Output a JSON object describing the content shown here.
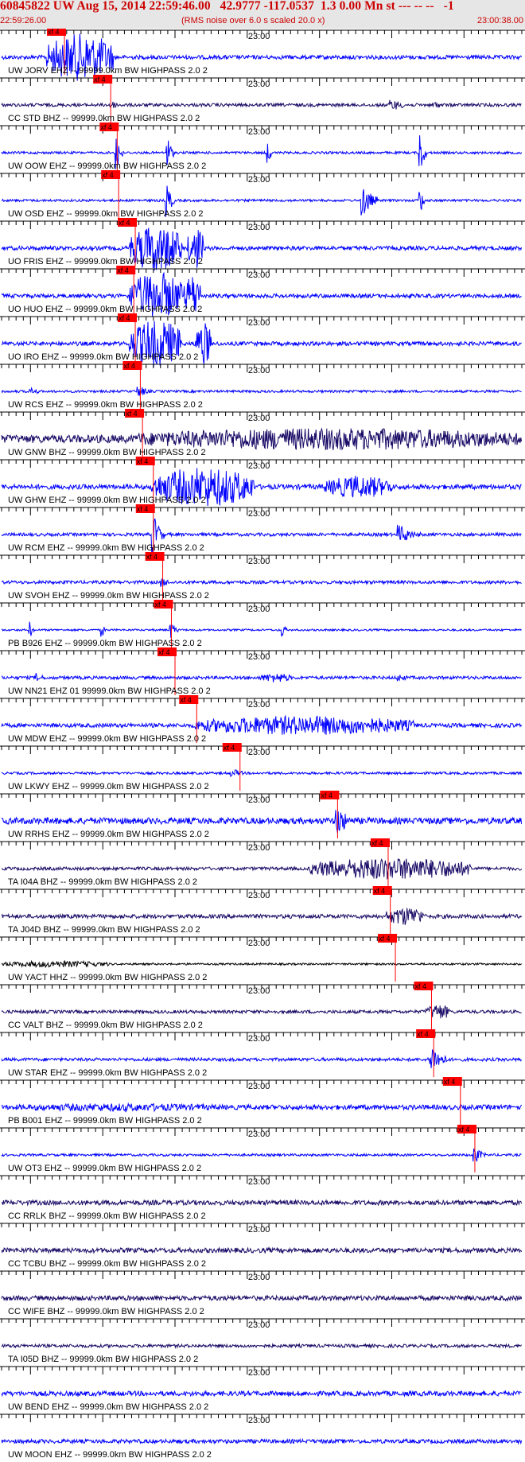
{
  "header": {
    "title": "60845822 UW Aug 15, 2014 22:59:46.00   42.9777 -117.0537  1.3 0.00 Mn st --- -- --   -1",
    "start_time": "22:59:26.00",
    "rms_note": "(RMS noise over 6.0 s scaled 20.0 x)",
    "end_time": "23:00:38.00"
  },
  "colors": {
    "blue": "#0000ff",
    "dark": "#1a0a66",
    "black": "#000000",
    "pick": "#ff0000",
    "header_bg": "#e6e6e6",
    "header_text": "#cc0000"
  },
  "chart_data": {
    "type": "line",
    "time_axis": {
      "start": "22:59:26.00",
      "end": "23:00:38.00",
      "minute_label": "23:00",
      "minute_offset_s": 34,
      "range_s": [
        0,
        72
      ]
    },
    "pick_label": "xf 4",
    "traces": [
      {
        "label": "UW JORV EHZ -- 99999.0km BW  HIGHPASS  2.0  2",
        "color": "blue",
        "pick_s": 8.7,
        "base": 2.5,
        "events": [
          {
            "t": 6.5,
            "dur": 9,
            "amp": 30,
            "dense": true
          }
        ]
      },
      {
        "label": "CC STD BHZ -- 99999.0km BW  HIGHPASS  2.0  2",
        "color": "dark",
        "pick_s": 15.1,
        "base": 2,
        "events": [
          {
            "t": 15,
            "dur": 2,
            "amp": 6
          },
          {
            "t": 54,
            "dur": 3,
            "amp": 7
          },
          {
            "t": 60,
            "dur": 1.5,
            "amp": 5
          }
        ]
      },
      {
        "label": "UW OOW EHZ -- 99999.0km BW  HIGHPASS  2.0  2",
        "color": "blue",
        "pick_s": 16,
        "base": 1.5,
        "events": [
          {
            "t": 16,
            "dur": 0.8,
            "amp": 25
          },
          {
            "t": 23,
            "dur": 0.8,
            "amp": 20
          },
          {
            "t": 37,
            "dur": 0.5,
            "amp": 12
          },
          {
            "t": 58,
            "dur": 0.8,
            "amp": 25
          }
        ]
      },
      {
        "label": "UW OSD EHZ -- 99999.0km BW  HIGHPASS  2.0  2",
        "color": "blue",
        "pick_s": 16.2,
        "base": 1.5,
        "events": [
          {
            "t": 23,
            "dur": 1,
            "amp": 18
          },
          {
            "t": 50,
            "dur": 2,
            "amp": 20
          },
          {
            "t": 58,
            "dur": 0.5,
            "amp": 18
          }
        ]
      },
      {
        "label": "UO FRIS EHZ -- 99999.0km BW  HIGHPASS  2.0  2",
        "color": "blue",
        "pick_s": 18.5,
        "base": 2.5,
        "events": [
          {
            "t": 18,
            "dur": 7,
            "amp": 30,
            "dense": true
          },
          {
            "t": 26,
            "dur": 2,
            "amp": 28,
            "dense": true
          }
        ]
      },
      {
        "label": "UO HUO EHZ -- 99999.0km BW  HIGHPASS  2.0  2",
        "color": "blue",
        "pick_s": 18.3,
        "base": 2.5,
        "events": [
          {
            "t": 18,
            "dur": 7,
            "amp": 30,
            "dense": true
          },
          {
            "t": 25.5,
            "dur": 2,
            "amp": 28,
            "dense": true
          }
        ]
      },
      {
        "label": "UO IRO EHZ -- 99999.0km BW  HIGHPASS  2.0  2",
        "color": "blue",
        "pick_s": 18.5,
        "base": 2.5,
        "events": [
          {
            "t": 18,
            "dur": 7,
            "amp": 30,
            "dense": true
          },
          {
            "t": 27,
            "dur": 2,
            "amp": 28,
            "dense": true
          }
        ]
      },
      {
        "label": "UW RCS EHZ -- 99999.0km BW  HIGHPASS  2.0  2",
        "color": "blue",
        "pick_s": 19.2,
        "base": 1.5,
        "events": [
          {
            "t": 4,
            "dur": 2,
            "amp": 5
          },
          {
            "t": 19,
            "dur": 2,
            "amp": 7
          }
        ]
      },
      {
        "label": "UW GNW BHZ -- 99999.0km BW  HIGHPASS  2.0  2",
        "color": "dark",
        "pick_s": 19.5,
        "base": 5,
        "events": [
          {
            "t": 19,
            "dur": 53,
            "amp": 14,
            "dense": true
          }
        ]
      },
      {
        "label": "UW GHW EHZ -- 99999.0km BW  HIGHPASS  2.0  2",
        "color": "blue",
        "pick_s": 21,
        "base": 3,
        "events": [
          {
            "t": 21,
            "dur": 14,
            "amp": 25,
            "dense": true
          },
          {
            "t": 45,
            "dur": 9,
            "amp": 14,
            "dense": true
          }
        ]
      },
      {
        "label": "UW RCM EHZ -- 99999.0km BW  HIGHPASS  2.0  2",
        "color": "blue",
        "pick_s": 21,
        "base": 2,
        "events": [
          {
            "t": 21,
            "dur": 1.5,
            "amp": 25
          },
          {
            "t": 55,
            "dur": 3,
            "amp": 12
          }
        ]
      },
      {
        "label": "UW SVOH EHZ -- 99999.0km BW  HIGHPASS  2.0  2",
        "color": "blue",
        "pick_s": 22.3,
        "base": 2,
        "events": [
          {
            "t": 22.3,
            "dur": 1.5,
            "amp": 6
          }
        ]
      },
      {
        "label": "PB B926 EHZ -- 99999.0km BW  HIGHPASS  2.0  2",
        "color": "blue",
        "pick_s": 23.5,
        "base": 1.2,
        "events": [
          {
            "t": 4,
            "dur": 0.5,
            "amp": 9
          },
          {
            "t": 14,
            "dur": 0.5,
            "amp": 7
          },
          {
            "t": 23.5,
            "dur": 1,
            "amp": 10
          },
          {
            "t": 39,
            "dur": 0.5,
            "amp": 8
          }
        ]
      },
      {
        "label": "UW NN21 EHZ 01 99999.0km BW  HIGHPASS  2.0  2",
        "color": "blue",
        "pick_s": 24,
        "base": 2,
        "events": [
          {
            "t": 5,
            "dur": 1.5,
            "amp": 5
          },
          {
            "t": 36,
            "dur": 4,
            "amp": 6,
            "dense": true
          },
          {
            "t": 55,
            "dur": 2,
            "amp": 5
          }
        ]
      },
      {
        "label": "UW MDW EHZ -- 99999.0km BW  HIGHPASS  2.0  2",
        "color": "blue",
        "pick_s": 27,
        "base": 2.5,
        "events": [
          {
            "t": 27,
            "dur": 30,
            "amp": 12,
            "dense": true
          }
        ]
      },
      {
        "label": "UW LKWY EHZ -- 99999.0km BW  HIGHPASS  2.0  2",
        "color": "blue",
        "pick_s": 33,
        "base": 1.5,
        "events": [
          {
            "t": 32,
            "dur": 2.5,
            "amp": 5
          }
        ]
      },
      {
        "label": "UW RRHS EHZ -- 99999.0km BW  HIGHPASS  2.0  2",
        "color": "blue",
        "pick_s": 46.5,
        "base": 4,
        "events": [
          {
            "t": 46.5,
            "dur": 2,
            "amp": 20
          }
        ]
      },
      {
        "label": "TA I04A BHZ -- 99999.0km BW  HIGHPASS  2.0  2",
        "color": "dark",
        "pick_s": 53.5,
        "base": 2,
        "events": [
          {
            "t": 43,
            "dur": 22,
            "amp": 14,
            "dense": true
          }
        ]
      },
      {
        "label": "TA J04D BHZ -- 99999.0km BW  HIGHPASS  2.0  2",
        "color": "dark",
        "pick_s": 53.8,
        "base": 2.5,
        "events": [
          {
            "t": 53.5,
            "dur": 5,
            "amp": 12,
            "dense": true
          }
        ]
      },
      {
        "label": "UW YACT HHZ -- 99999.0km BW  HIGHPASS  2.0  2",
        "color": "black",
        "pick_s": 54.5,
        "base": 1.2,
        "events": [
          {
            "t": 0,
            "dur": 15,
            "amp": 4,
            "dense": true
          }
        ]
      },
      {
        "label": "CC VALT BHZ -- 99999.0km BW  HIGHPASS  2.0  2",
        "color": "dark",
        "pick_s": 59.5,
        "base": 2,
        "events": [
          {
            "t": 59,
            "dur": 3,
            "amp": 10,
            "dense": true
          }
        ]
      },
      {
        "label": "UW STAR EHZ -- 99999.0km BW  HIGHPASS  2.0  2",
        "color": "blue",
        "pick_s": 59.8,
        "base": 2,
        "events": [
          {
            "t": 59.5,
            "dur": 2.5,
            "amp": 18
          }
        ]
      },
      {
        "label": "PB B001 EHZ -- 99999.0km BW  HIGHPASS  2.0  2",
        "color": "blue",
        "pick_s": 63.5,
        "base": 3,
        "events": [
          {
            "t": 0,
            "dur": 32,
            "amp": 5,
            "dense": true
          }
        ]
      },
      {
        "label": "UW OT3 EHZ -- 99999.0km BW  HIGHPASS  2.0  2",
        "color": "blue",
        "pick_s": 65.5,
        "base": 1.5,
        "events": [
          {
            "t": 65.5,
            "dur": 1.5,
            "amp": 10
          }
        ]
      },
      {
        "label": "CC RRLK BHZ -- 99999.0km BW  HIGHPASS  2.0  2",
        "color": "dark",
        "pick_s": null,
        "base": 3,
        "events": []
      },
      {
        "label": "CC TCBU BHZ -- 99999.0km BW  HIGHPASS  2.0  2",
        "color": "dark",
        "pick_s": null,
        "base": 3,
        "events": []
      },
      {
        "label": "CC WIFE BHZ -- 99999.0km BW  HIGHPASS  2.0  2",
        "color": "dark",
        "pick_s": null,
        "base": 3,
        "events": []
      },
      {
        "label": "TA I05D BHZ -- 99999.0km BW  HIGHPASS  2.0  2",
        "color": "dark",
        "pick_s": null,
        "base": 2,
        "events": []
      },
      {
        "label": "UW BEND EHZ -- 99999.0km BW  HIGHPASS  2.0  2",
        "color": "blue",
        "pick_s": null,
        "base": 3,
        "events": []
      },
      {
        "label": "UW MOON EHZ -- 99999.0km BW  HIGHPASS  2.0  2",
        "color": "blue",
        "pick_s": null,
        "base": 2.5,
        "events": []
      }
    ]
  }
}
